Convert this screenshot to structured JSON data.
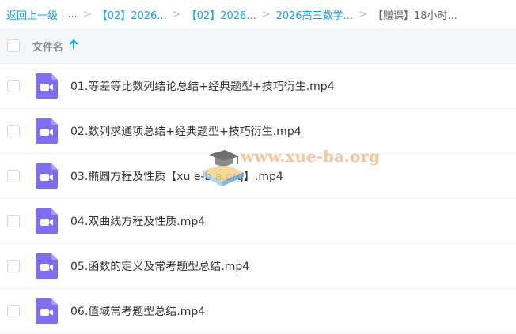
{
  "breadcrumb": {
    "back": "返回上一级",
    "ellipsis": "...",
    "items": [
      "【02】2026...",
      "【02】2026...",
      "2026高三数学..."
    ],
    "current": "【赠课】18小时..."
  },
  "header": {
    "column_title": "文件名",
    "sort_icon": "arrow-up-icon"
  },
  "files": [
    {
      "name": "01.等差等比数列结论总结+经典题型+技巧衍生.mp4"
    },
    {
      "name": "02.数列求通项总结+经典题型+技巧衍生.mp4"
    },
    {
      "name": "03.椭圆方程及性质【xu e-b a.org】.mp4"
    },
    {
      "name": "04.双曲线方程及性质.mp4"
    },
    {
      "name": "05.函数的定义及常考题型总结.mp4"
    },
    {
      "name": "06.值域常考题型总结.mp4"
    }
  ],
  "watermark": {
    "text": "www.xue-ba.org"
  },
  "colors": {
    "accent": "#06a7ff",
    "video_icon": "#7c6df3",
    "header_bg": "#f5f6f7"
  }
}
